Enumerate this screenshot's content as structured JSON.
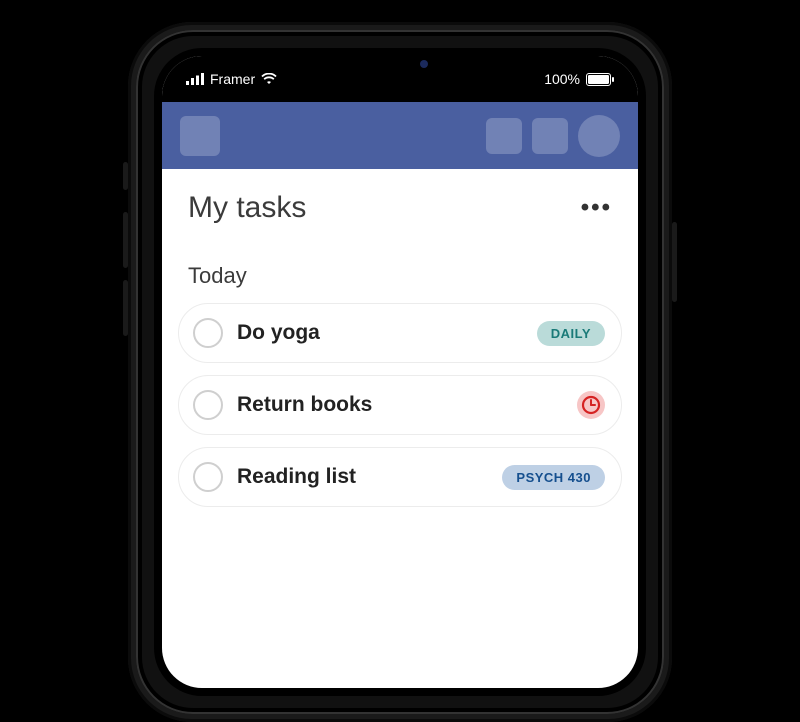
{
  "statusbar": {
    "carrier": "Framer",
    "battery": "100%"
  },
  "header": {
    "icons": {
      "left": "menu-placeholder",
      "right1": "action-placeholder-1",
      "right2": "action-placeholder-2",
      "avatar": "avatar-placeholder"
    }
  },
  "page": {
    "title": "My tasks",
    "more": "•••"
  },
  "sections": [
    {
      "heading": "Today",
      "tasks": [
        {
          "label": "Do yoga",
          "badge_type": "pill",
          "badge_text": "DAILY",
          "badge_style": "teal"
        },
        {
          "label": "Return books",
          "badge_type": "clock"
        },
        {
          "label": "Reading list",
          "badge_type": "pill",
          "badge_text": "PSYCH 430",
          "badge_style": "blue"
        }
      ]
    }
  ],
  "colors": {
    "header_bg": "#4a5fa0",
    "clock_red": "#d52222"
  }
}
